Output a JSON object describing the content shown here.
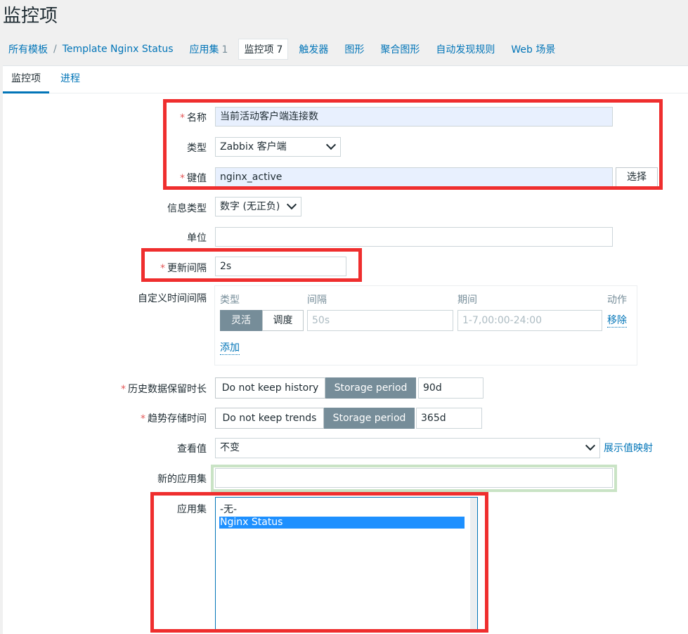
{
  "page_title": "监控项",
  "breadcrumb": {
    "all_templates": "所有模板",
    "separator": "/",
    "template": "Template Nginx Status"
  },
  "nav": [
    {
      "label": "应用集",
      "count": "1"
    },
    {
      "label": "监控项",
      "count": "7",
      "active": true
    },
    {
      "label": "触发器",
      "count": ""
    },
    {
      "label": "图形",
      "count": ""
    },
    {
      "label": "聚合图形",
      "count": ""
    },
    {
      "label": "自动发现规则",
      "count": ""
    },
    {
      "label": "Web 场景",
      "count": ""
    }
  ],
  "tabs": [
    "监控项",
    "进程"
  ],
  "form": {
    "name": {
      "label": "名称",
      "value": "当前活动客户端连接数"
    },
    "type": {
      "label": "类型",
      "value": "Zabbix 客户端"
    },
    "key": {
      "label": "键值",
      "value": "nginx_active",
      "button": "选择"
    },
    "info_type": {
      "label": "信息类型",
      "value": "数字 (无正负)"
    },
    "units": {
      "label": "单位",
      "value": ""
    },
    "update_interval": {
      "label": "更新间隔",
      "value": "2s"
    },
    "custom_intervals": {
      "label": "自定义时间间隔",
      "headers": [
        "类型",
        "间隔",
        "期间",
        "动作"
      ],
      "row": {
        "toggle_on": "灵活",
        "toggle_off": "调度",
        "interval_placeholder": "50s",
        "period_placeholder": "1-7,00:00-24:00",
        "remove": "移除"
      },
      "add": "添加"
    },
    "history": {
      "label": "历史数据保留时长",
      "opt_off": "Do not keep history",
      "opt_on": "Storage period",
      "value": "90d"
    },
    "trends": {
      "label": "趋势存储时间",
      "opt_off": "Do not keep trends",
      "opt_on": "Storage period",
      "value": "365d"
    },
    "show_value": {
      "label": "查看值",
      "value": "不变",
      "link": "展示值映射"
    },
    "new_application": {
      "label": "新的应用集",
      "value": ""
    },
    "applications": {
      "label": "应用集",
      "options": [
        "-无-",
        "Nginx Status"
      ],
      "selected": "Nginx Status"
    }
  },
  "colors": {
    "accent": "#0275b8",
    "highlight_red": "#ef2e2e",
    "required": "#e45959",
    "toggle_on": "#768d99"
  }
}
